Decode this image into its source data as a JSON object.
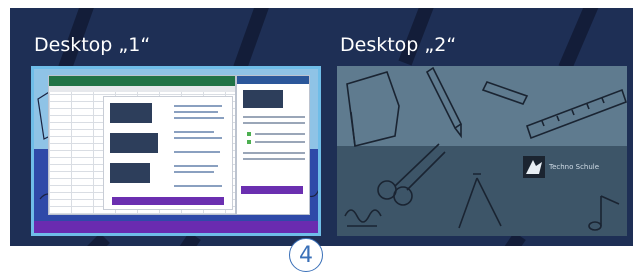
{
  "task_view": {
    "desktops": [
      {
        "title": "Desktop „1“",
        "selected": true
      },
      {
        "title": "Desktop „2“",
        "selected": false
      }
    ]
  },
  "desktop2": {
    "brand_text": "Techno Schule"
  },
  "badge": {
    "number": "4"
  },
  "colors": {
    "background": "#1e2f55",
    "selection_border": "#6fbde8",
    "badge_color": "#3a70b8",
    "excel_green": "#217346",
    "word_blue": "#2b579a",
    "taskbar_purple": "#6a2bb0"
  }
}
